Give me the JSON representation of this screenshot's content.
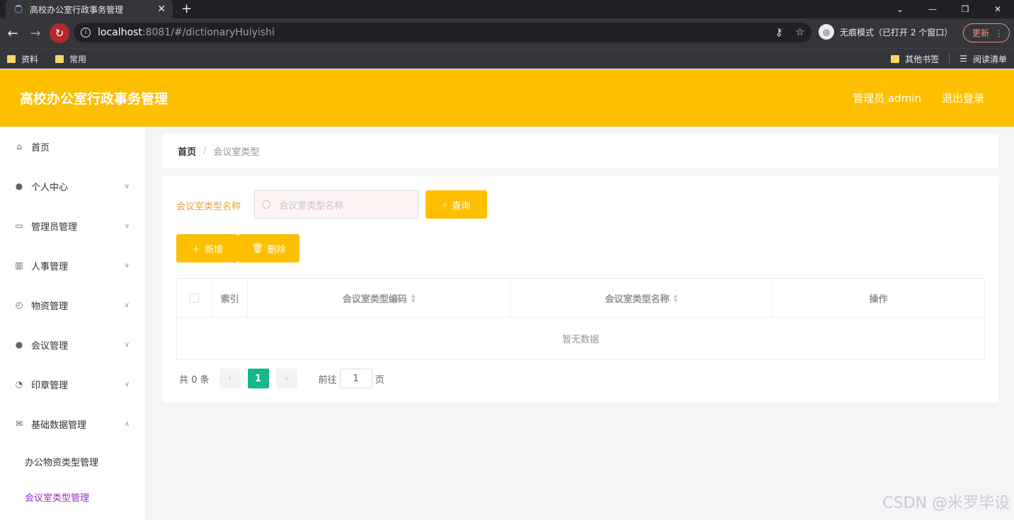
{
  "browser": {
    "tab_title": "高校办公室行政事务管理",
    "url_host": "localhost",
    "url_path": ":8081/#/dictionaryHuiyishi",
    "incognito_label": "无痕模式（已打开 2 个窗口）",
    "update_label": "更新",
    "bookmarks": [
      "资料",
      "常用"
    ],
    "bookmarks_right": [
      "其他书签",
      "阅读清单"
    ]
  },
  "header": {
    "title": "高校办公室行政事务管理",
    "user": "管理员 admin",
    "logout": "退出登录"
  },
  "sidebar": {
    "items": [
      {
        "label": "首页",
        "icon": "home-icon"
      },
      {
        "label": "个人中心",
        "icon": "user-icon"
      },
      {
        "label": "管理员管理",
        "icon": "id-card-icon"
      },
      {
        "label": "人事管理",
        "icon": "books-icon"
      },
      {
        "label": "物资管理",
        "icon": "compass-icon"
      },
      {
        "label": "会议管理",
        "icon": "bulb-icon"
      },
      {
        "label": "印章管理",
        "icon": "gauge-icon"
      },
      {
        "label": "基础数据管理",
        "icon": "mail-icon"
      }
    ],
    "subitems": [
      {
        "label": "办公物资类型管理"
      },
      {
        "label": "会议室类型管理"
      }
    ]
  },
  "breadcrumb": {
    "home": "首页",
    "current": "会议室类型"
  },
  "search": {
    "label": "会议室类型名称",
    "placeholder": "会议室类型名称",
    "button": "查询"
  },
  "actions": {
    "add": "新增",
    "delete": "删除"
  },
  "table": {
    "columns": [
      "索引",
      "会议室类型编码",
      "会议室类型名称",
      "操作"
    ],
    "empty_text": "暂无数据"
  },
  "pagination": {
    "total": "共 0 条",
    "current_page": "1",
    "goto_label": "前往",
    "goto_value": "1",
    "page_suffix": "页"
  },
  "watermark": "CSDN @米罗毕设",
  "colors": {
    "accent": "#fdbf00",
    "active_page": "#14b88a",
    "active_menu": "#9b2cc4"
  }
}
